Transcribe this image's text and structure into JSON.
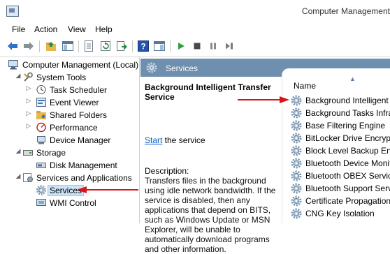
{
  "window": {
    "title": "Computer Management"
  },
  "menu": [
    "File",
    "Action",
    "View",
    "Help"
  ],
  "tree": {
    "root": "Computer Management (Local)",
    "system_tools": "System Tools",
    "task_scheduler": "Task Scheduler",
    "event_viewer": "Event Viewer",
    "shared_folders": "Shared Folders",
    "performance": "Performance",
    "device_manager": "Device Manager",
    "storage": "Storage",
    "disk_management": "Disk Management",
    "services_apps": "Services and Applications",
    "services": "Services",
    "wmi_control": "WMI Control"
  },
  "services_panel": {
    "header": "Services",
    "selected_title": "Background Intelligent Transfer Service",
    "start_link": "Start",
    "start_suffix": " the service",
    "description_label": "Description:",
    "description_text": "Transfers files in the background using idle network bandwidth. If the service is disabled, then any applications that depend on BITS, such as Windows Update or MSN Explorer, will be unable to automatically download programs and other information.",
    "column_name": "Name",
    "items": [
      "Background Intelligent Tr",
      "Background Tasks Infrast",
      "Base Filtering Engine",
      "BitLocker Drive Encryptio",
      "Block Level Backup Engin",
      "Bluetooth Device Monito",
      "Bluetooth OBEX Service",
      "Bluetooth Support Servi",
      "Certificate Propagation",
      "CNG Key Isolation"
    ]
  },
  "colors": {
    "header_bg": "#6f8fae",
    "arrow": "#d9121b",
    "link": "#0b5fc7"
  }
}
